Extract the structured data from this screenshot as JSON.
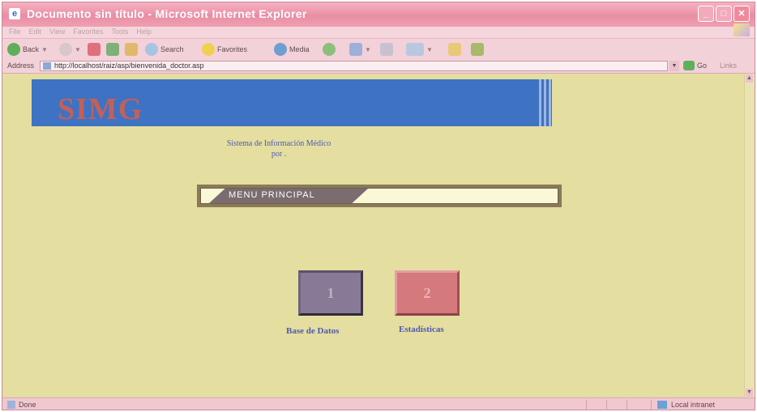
{
  "window": {
    "title": "Documento sin título - Microsoft Internet Explorer"
  },
  "menubar": {
    "items": [
      "File",
      "Edit",
      "View",
      "Favorites",
      "Tools",
      "Help"
    ]
  },
  "toolbar": {
    "back_label": "Back",
    "search_label": "Search",
    "favorites_label": "Favorites",
    "media_label": "Media"
  },
  "address": {
    "label": "Address",
    "url": "http://localhost/raiz/asp/bienvenida_doctor.asp",
    "go_label": "Go",
    "links_label": "Links"
  },
  "page": {
    "logo": "SIMG",
    "system_line1": "Sistema de Información Médico",
    "system_line2": "por .",
    "menu_title": "MENU PRINCIPAL",
    "tiles": [
      {
        "number": "1",
        "label": "Base de Datos"
      },
      {
        "number": "2",
        "label": "Estadísticas"
      }
    ]
  },
  "status": {
    "text": "Done",
    "zone": "Local intranet"
  }
}
